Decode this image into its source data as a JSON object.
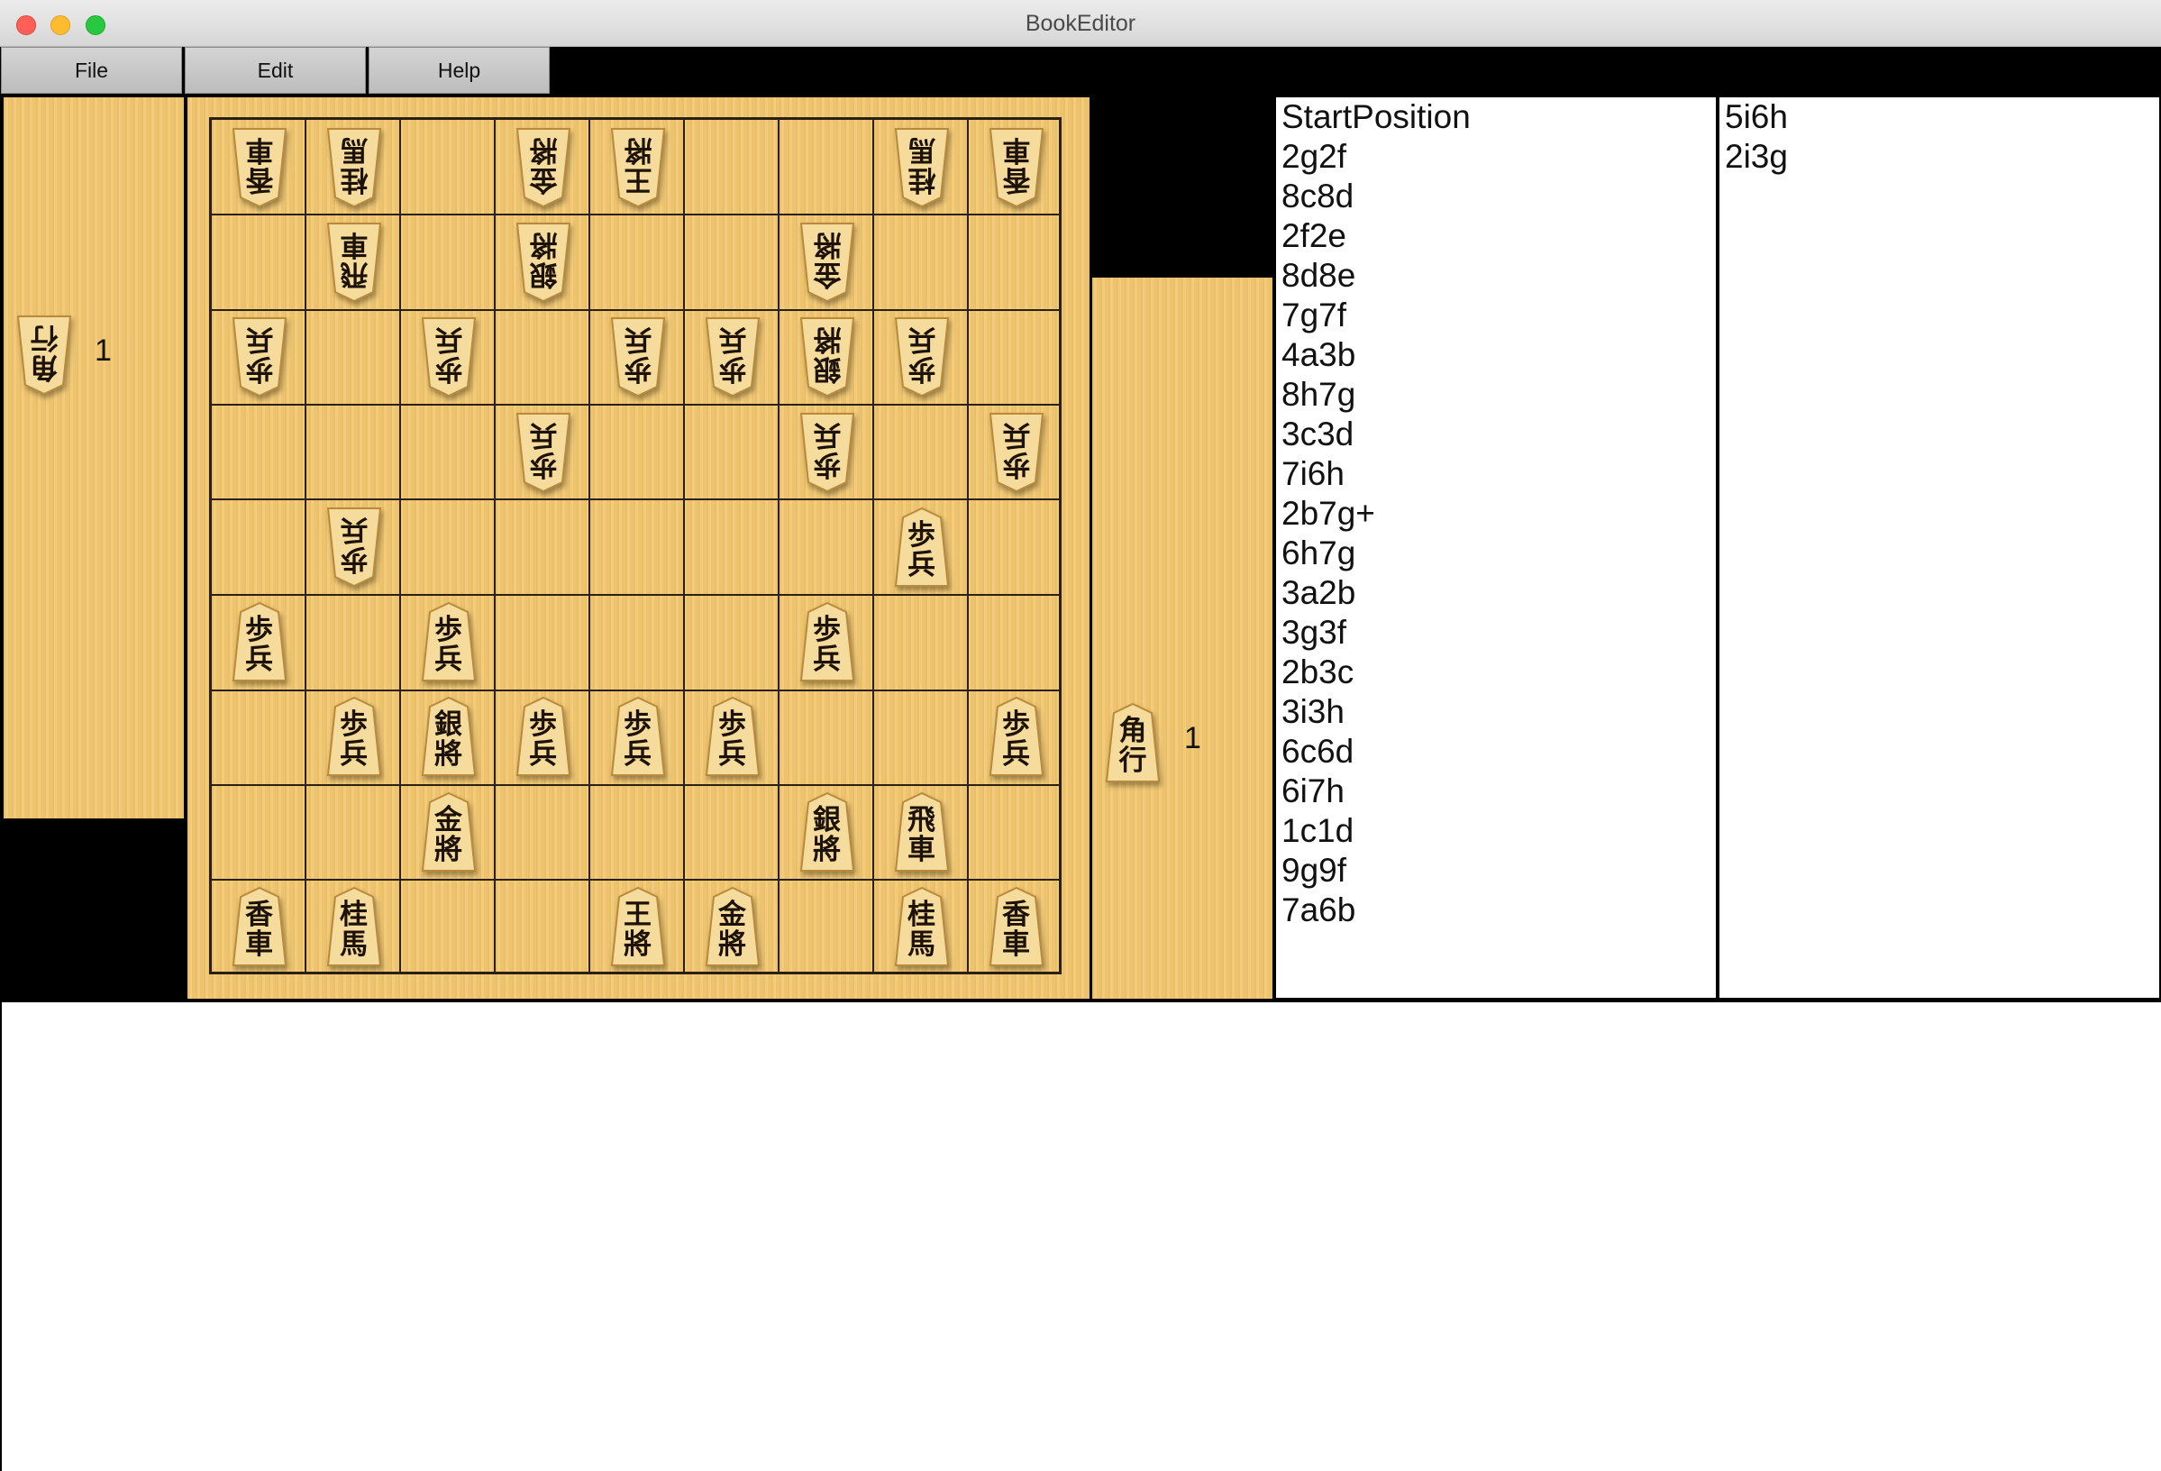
{
  "window": {
    "title": "BookEditor"
  },
  "menu": {
    "file": "File",
    "edit": "Edit",
    "help": "Help"
  },
  "hands": {
    "gote": {
      "piece": [
        "角",
        "行"
      ],
      "count": "1"
    },
    "sente": {
      "piece": [
        "角",
        "行"
      ],
      "count": "1"
    }
  },
  "board": {
    "board_rows": [
      [
        {
          "o": "g",
          "c": [
            "香",
            "車"
          ]
        },
        {
          "o": "g",
          "c": [
            "桂",
            "馬"
          ]
        },
        null,
        {
          "o": "g",
          "c": [
            "金",
            "將"
          ]
        },
        {
          "o": "g",
          "c": [
            "王",
            "將"
          ]
        },
        null,
        null,
        {
          "o": "g",
          "c": [
            "桂",
            "馬"
          ]
        },
        {
          "o": "g",
          "c": [
            "香",
            "車"
          ]
        }
      ],
      [
        null,
        {
          "o": "g",
          "c": [
            "飛",
            "車"
          ]
        },
        null,
        {
          "o": "g",
          "c": [
            "銀",
            "將"
          ]
        },
        null,
        null,
        {
          "o": "g",
          "c": [
            "金",
            "將"
          ]
        },
        null,
        null
      ],
      [
        {
          "o": "g",
          "c": [
            "歩",
            "兵"
          ]
        },
        null,
        {
          "o": "g",
          "c": [
            "歩",
            "兵"
          ]
        },
        null,
        {
          "o": "g",
          "c": [
            "歩",
            "兵"
          ]
        },
        {
          "o": "g",
          "c": [
            "歩",
            "兵"
          ]
        },
        {
          "o": "g",
          "c": [
            "銀",
            "將"
          ]
        },
        {
          "o": "g",
          "c": [
            "歩",
            "兵"
          ]
        },
        null
      ],
      [
        null,
        null,
        null,
        {
          "o": "g",
          "c": [
            "歩",
            "兵"
          ]
        },
        null,
        null,
        {
          "o": "g",
          "c": [
            "歩",
            "兵"
          ]
        },
        null,
        {
          "o": "g",
          "c": [
            "歩",
            "兵"
          ]
        }
      ],
      [
        null,
        {
          "o": "g",
          "c": [
            "歩",
            "兵"
          ]
        },
        null,
        null,
        null,
        null,
        null,
        {
          "o": "s",
          "c": [
            "歩",
            "兵"
          ]
        },
        null
      ],
      [
        {
          "o": "s",
          "c": [
            "歩",
            "兵"
          ]
        },
        null,
        {
          "o": "s",
          "c": [
            "歩",
            "兵"
          ]
        },
        null,
        null,
        null,
        {
          "o": "s",
          "c": [
            "歩",
            "兵"
          ]
        },
        null,
        null
      ],
      [
        null,
        {
          "o": "s",
          "c": [
            "歩",
            "兵"
          ]
        },
        {
          "o": "s",
          "c": [
            "銀",
            "將"
          ]
        },
        {
          "o": "s",
          "c": [
            "歩",
            "兵"
          ]
        },
        {
          "o": "s",
          "c": [
            "歩",
            "兵"
          ]
        },
        {
          "o": "s",
          "c": [
            "歩",
            "兵"
          ]
        },
        null,
        null,
        {
          "o": "s",
          "c": [
            "歩",
            "兵"
          ]
        }
      ],
      [
        null,
        null,
        {
          "o": "s",
          "c": [
            "金",
            "將"
          ]
        },
        null,
        null,
        null,
        {
          "o": "s",
          "c": [
            "銀",
            "將"
          ]
        },
        {
          "o": "s",
          "c": [
            "飛",
            "車"
          ]
        },
        null
      ],
      [
        {
          "o": "s",
          "c": [
            "香",
            "車"
          ]
        },
        {
          "o": "s",
          "c": [
            "桂",
            "馬"
          ]
        },
        null,
        null,
        {
          "o": "s",
          "c": [
            "王",
            "將"
          ]
        },
        {
          "o": "s",
          "c": [
            "金",
            "將"
          ]
        },
        null,
        {
          "o": "s",
          "c": [
            "桂",
            "馬"
          ]
        },
        {
          "o": "s",
          "c": [
            "香",
            "車"
          ]
        }
      ]
    ]
  },
  "moves": [
    "StartPosition",
    "2g2f",
    "8c8d",
    "2f2e",
    "8d8e",
    "7g7f",
    "4a3b",
    "8h7g",
    "3c3d",
    "7i6h",
    "2b7g+",
    "6h7g",
    "3a2b",
    "3g3f",
    "2b3c",
    "3i3h",
    "6c6d",
    "6i7h",
    "1c1d",
    "9g9f",
    "7a6b"
  ],
  "candidates": [
    "5i6h",
    "2i3g"
  ],
  "colors": {
    "wood": "#f1c873",
    "piece_face": "#f6dc9c",
    "line": "#2a2114"
  }
}
